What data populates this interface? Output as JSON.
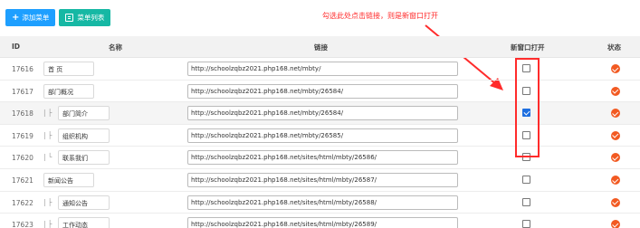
{
  "toolbar": {
    "add_menu_label": "添加菜单",
    "menu_list_label": "菜单列表",
    "add_icon": "plus-icon",
    "list_icon": "list-icon"
  },
  "annotation": {
    "text": "勾选此处点击链接，则是新窗口打开",
    "color": "#ff2b2b"
  },
  "table": {
    "headers": {
      "id": "ID",
      "name": "名称",
      "link": "链接",
      "new_window": "新窗口打开",
      "status": "状态"
    },
    "rows": [
      {
        "id": "17616",
        "prefix": "",
        "name": "首 页",
        "link": "http://schoolzqbz2021.php168.net/mbty/",
        "new_window": false
      },
      {
        "id": "17617",
        "prefix": "",
        "name": "部门概况",
        "link": "http://schoolzqbz2021.php168.net/mbty/26584/",
        "new_window": false
      },
      {
        "id": "17618",
        "prefix": "| ├",
        "name": "部门简介",
        "link": "http://schoolzqbz2021.php168.net/mbty/26584/",
        "new_window": true
      },
      {
        "id": "17619",
        "prefix": "| ├",
        "name": "组织机构",
        "link": "http://schoolzqbz2021.php168.net/mbty/26585/",
        "new_window": false
      },
      {
        "id": "17620",
        "prefix": "| └",
        "name": "联系我们",
        "link": "http://schoolzqbz2021.php168.net/sites/html/mbty/26586/",
        "new_window": false
      },
      {
        "id": "17621",
        "prefix": "",
        "name": "新闻公告",
        "link": "http://schoolzqbz2021.php168.net/sites/html/mbty/26587/",
        "new_window": false
      },
      {
        "id": "17622",
        "prefix": "| ├",
        "name": "通知公告",
        "link": "http://schoolzqbz2021.php168.net/sites/html/mbty/26588/",
        "new_window": false
      },
      {
        "id": "17623",
        "prefix": "| ├",
        "name": "工作动态",
        "link": "http://schoolzqbz2021.php168.net/sites/html/mbty/26589/",
        "new_window": false
      }
    ]
  },
  "colors": {
    "primary": "#1e9fff",
    "secondary": "#16b8a4",
    "status": "#f25a22",
    "checkbox_checked": "#1e6fe0"
  }
}
